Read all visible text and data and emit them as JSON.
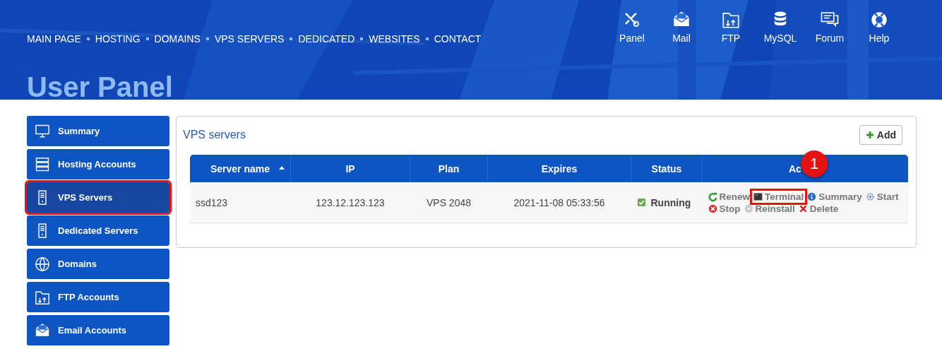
{
  "nav": [
    "MAIN PAGE",
    "HOSTING",
    "DOMAINS",
    "VPS SERVERS",
    "DEDICATED",
    "WEBSITES",
    "CONTACT"
  ],
  "tools": [
    {
      "kind": "panel",
      "label": "Panel"
    },
    {
      "kind": "mail",
      "label": "Mail"
    },
    {
      "kind": "ftp",
      "label": "FTP"
    },
    {
      "kind": "mysql",
      "label": "MySQL"
    },
    {
      "kind": "forum",
      "label": "Forum"
    },
    {
      "kind": "help",
      "label": "Help"
    }
  ],
  "page_title": "User Panel",
  "sidebar": {
    "items": [
      {
        "kind": "monitor",
        "label": "Summary",
        "selected": false,
        "highlighted": false
      },
      {
        "kind": "rack",
        "label": "Hosting Accounts",
        "selected": false,
        "highlighted": false
      },
      {
        "kind": "server",
        "label": "VPS Servers",
        "selected": true,
        "highlighted": true
      },
      {
        "kind": "server",
        "label": "Dedicated Servers",
        "selected": false,
        "highlighted": false
      },
      {
        "kind": "www",
        "label": "Domains",
        "selected": false,
        "highlighted": false
      },
      {
        "kind": "ftp",
        "label": "FTP Accounts",
        "selected": false,
        "highlighted": false
      },
      {
        "kind": "mail",
        "label": "Email Accounts",
        "selected": false,
        "highlighted": false
      }
    ]
  },
  "panel": {
    "title": "VPS servers",
    "add_button": "Add",
    "table": {
      "columns": [
        {
          "label": "Server name",
          "sorted": true
        },
        {
          "label": "IP",
          "sorted": false
        },
        {
          "label": "Plan",
          "sorted": false
        },
        {
          "label": "Expires",
          "sorted": false
        },
        {
          "label": "Status",
          "sorted": false
        },
        {
          "label": "Ac",
          "sorted": false
        }
      ],
      "rows": [
        {
          "server_name": "ssd123",
          "ip": "123.12.123.123",
          "plan": "VPS 2048",
          "expires": "2021-11-08 05:33:56",
          "status": "Running",
          "running": true,
          "actions": [
            [
              {
                "kind": "renew",
                "label": "Renew",
                "highlighted": false
              },
              {
                "kind": "terminal",
                "label": "Terminal",
                "highlighted": true
              },
              {
                "kind": "summary",
                "label": "Summary",
                "highlighted": false
              },
              {
                "kind": "start",
                "label": "Start",
                "highlighted": false
              }
            ],
            [
              {
                "kind": "stop",
                "label": "Stop",
                "highlighted": false
              },
              {
                "kind": "reinstall",
                "label": "Reinstall",
                "highlighted": false
              },
              {
                "kind": "delete",
                "label": "Delete",
                "highlighted": false
              }
            ]
          ]
        }
      ]
    }
  },
  "step_badge": "1"
}
